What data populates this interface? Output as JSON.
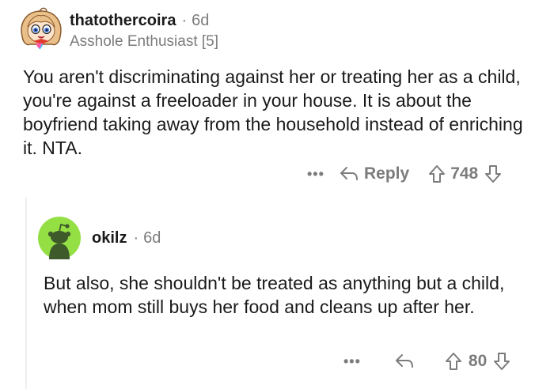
{
  "comment1": {
    "username": "thatothercoira",
    "age": "6d",
    "flair": "Asshole Enthusiast [5]",
    "body": "You aren't discriminating against her or treating her as a child, you're against a freeloader in your house. It is about the boyfriend taking away from the household instead of enriching it. NTA.",
    "more_label": "•••",
    "reply_label": "Reply",
    "score": "748"
  },
  "comment2": {
    "username": "okilz",
    "age": "6d",
    "body": "But also, she shouldn't be treated as anything but a child,  when mom still buys her food and cleans up after her.",
    "more_label": "•••",
    "score": "80"
  },
  "separator": "·",
  "colors": {
    "text": "#1a1a1b",
    "meta": "#7c7c7c",
    "avatar_green": "#94e044",
    "snoo_dark": "#3e5a2a"
  },
  "icons": [
    "cartoon-avatar-icon",
    "snoo-avatar-icon",
    "reply-arrow-icon",
    "upvote-icon",
    "downvote-icon",
    "more-dots-icon"
  ]
}
